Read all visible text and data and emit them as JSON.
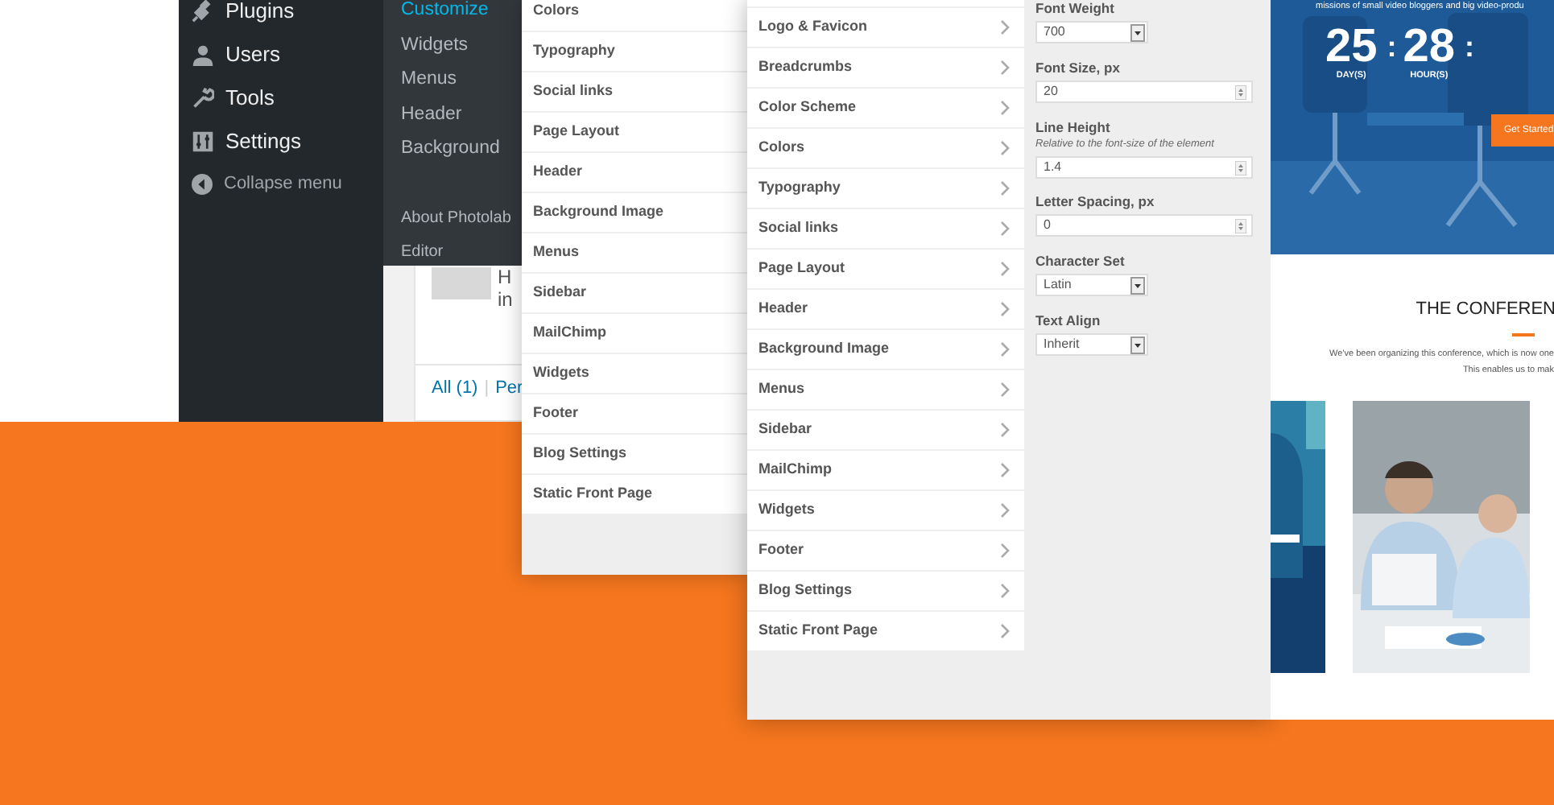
{
  "admin_menu": {
    "items": [
      {
        "label": "Plugins"
      },
      {
        "label": "Users"
      },
      {
        "label": "Tools"
      },
      {
        "label": "Settings"
      }
    ],
    "collapse": "Collapse menu"
  },
  "submenu": {
    "items": [
      {
        "label": "Customize",
        "selected": true
      },
      {
        "label": "Widgets",
        "selected": false
      },
      {
        "label": "Menus",
        "selected": false
      },
      {
        "label": "Header",
        "selected": false
      },
      {
        "label": "Background",
        "selected": false
      }
    ],
    "extra_items": [
      {
        "label": "About Photolab",
        "selected": false
      },
      {
        "label": "Editor",
        "selected": false
      }
    ]
  },
  "content_behind": {
    "texts": [
      "H",
      "in"
    ],
    "filters": [
      "All (1)",
      "|",
      "Per"
    ]
  },
  "panel_1": {
    "items": [
      "Colors",
      "Typography",
      "Social links",
      "Page Layout",
      "Header",
      "Background Image",
      "Menus",
      "Sidebar",
      "MailChimp",
      "Widgets",
      "Footer",
      "Blog Settings",
      "Static Front Page"
    ]
  },
  "panel_2": {
    "items": [
      "Logo & Favicon",
      "Breadcrumbs",
      "Color Scheme",
      "Colors",
      "Typography",
      "Social links",
      "Page Layout",
      "Header",
      "Background Image",
      "Menus",
      "Sidebar",
      "MailChimp",
      "Widgets",
      "Footer",
      "Blog Settings",
      "Static Front Page"
    ],
    "controls": [
      {
        "kind": "select",
        "label": "Font Weight",
        "value": "700"
      },
      {
        "kind": "number",
        "label": "Font Size, px",
        "value": "20"
      },
      {
        "kind": "number",
        "label": "Line Height",
        "hint": "Relative to the font-size of the element",
        "value": "1.4"
      },
      {
        "kind": "number",
        "label": "Letter Spacing, px",
        "value": "0"
      },
      {
        "kind": "select",
        "label": "Character Set",
        "value": "Latin"
      },
      {
        "kind": "select",
        "label": "Text Align",
        "value": "Inherit"
      }
    ]
  },
  "preview": {
    "hero_text": "missions of small video bloggers and big video-produ",
    "countdown": [
      {
        "value": "25",
        "unit": "DAY(S)",
        "separator": ":"
      },
      {
        "value": "28",
        "unit": "HOUR(S)",
        "separator": ":"
      }
    ],
    "button": "Get Started",
    "section_title": "THE CONFEREN",
    "paragraph_lines": [
      "We've been organizing this conference, which is now one",
      "This enables us to mak"
    ]
  }
}
